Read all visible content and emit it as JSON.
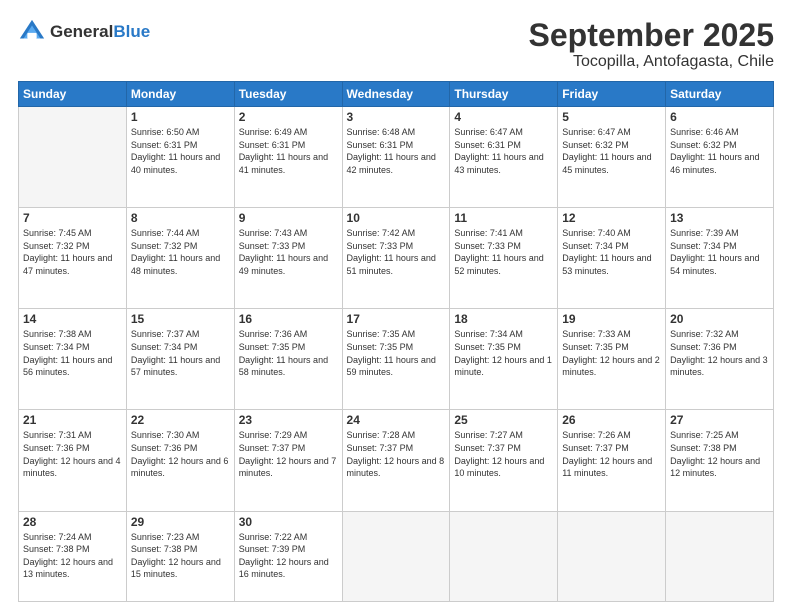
{
  "header": {
    "logo_general": "General",
    "logo_blue": "Blue",
    "main_title": "September 2025",
    "sub_title": "Tocopilla, Antofagasta, Chile"
  },
  "days_of_week": [
    "Sunday",
    "Monday",
    "Tuesday",
    "Wednesday",
    "Thursday",
    "Friday",
    "Saturday"
  ],
  "weeks": [
    [
      {
        "day": "",
        "info": ""
      },
      {
        "day": "1",
        "sunrise": "Sunrise: 6:50 AM",
        "sunset": "Sunset: 6:31 PM",
        "daylight": "Daylight: 11 hours and 40 minutes."
      },
      {
        "day": "2",
        "sunrise": "Sunrise: 6:49 AM",
        "sunset": "Sunset: 6:31 PM",
        "daylight": "Daylight: 11 hours and 41 minutes."
      },
      {
        "day": "3",
        "sunrise": "Sunrise: 6:48 AM",
        "sunset": "Sunset: 6:31 PM",
        "daylight": "Daylight: 11 hours and 42 minutes."
      },
      {
        "day": "4",
        "sunrise": "Sunrise: 6:47 AM",
        "sunset": "Sunset: 6:31 PM",
        "daylight": "Daylight: 11 hours and 43 minutes."
      },
      {
        "day": "5",
        "sunrise": "Sunrise: 6:47 AM",
        "sunset": "Sunset: 6:32 PM",
        "daylight": "Daylight: 11 hours and 45 minutes."
      },
      {
        "day": "6",
        "sunrise": "Sunrise: 6:46 AM",
        "sunset": "Sunset: 6:32 PM",
        "daylight": "Daylight: 11 hours and 46 minutes."
      }
    ],
    [
      {
        "day": "7",
        "sunrise": "Sunrise: 7:45 AM",
        "sunset": "Sunset: 7:32 PM",
        "daylight": "Daylight: 11 hours and 47 minutes."
      },
      {
        "day": "8",
        "sunrise": "Sunrise: 7:44 AM",
        "sunset": "Sunset: 7:32 PM",
        "daylight": "Daylight: 11 hours and 48 minutes."
      },
      {
        "day": "9",
        "sunrise": "Sunrise: 7:43 AM",
        "sunset": "Sunset: 7:33 PM",
        "daylight": "Daylight: 11 hours and 49 minutes."
      },
      {
        "day": "10",
        "sunrise": "Sunrise: 7:42 AM",
        "sunset": "Sunset: 7:33 PM",
        "daylight": "Daylight: 11 hours and 51 minutes."
      },
      {
        "day": "11",
        "sunrise": "Sunrise: 7:41 AM",
        "sunset": "Sunset: 7:33 PM",
        "daylight": "Daylight: 11 hours and 52 minutes."
      },
      {
        "day": "12",
        "sunrise": "Sunrise: 7:40 AM",
        "sunset": "Sunset: 7:34 PM",
        "daylight": "Daylight: 11 hours and 53 minutes."
      },
      {
        "day": "13",
        "sunrise": "Sunrise: 7:39 AM",
        "sunset": "Sunset: 7:34 PM",
        "daylight": "Daylight: 11 hours and 54 minutes."
      }
    ],
    [
      {
        "day": "14",
        "sunrise": "Sunrise: 7:38 AM",
        "sunset": "Sunset: 7:34 PM",
        "daylight": "Daylight: 11 hours and 56 minutes."
      },
      {
        "day": "15",
        "sunrise": "Sunrise: 7:37 AM",
        "sunset": "Sunset: 7:34 PM",
        "daylight": "Daylight: 11 hours and 57 minutes."
      },
      {
        "day": "16",
        "sunrise": "Sunrise: 7:36 AM",
        "sunset": "Sunset: 7:35 PM",
        "daylight": "Daylight: 11 hours and 58 minutes."
      },
      {
        "day": "17",
        "sunrise": "Sunrise: 7:35 AM",
        "sunset": "Sunset: 7:35 PM",
        "daylight": "Daylight: 11 hours and 59 minutes."
      },
      {
        "day": "18",
        "sunrise": "Sunrise: 7:34 AM",
        "sunset": "Sunset: 7:35 PM",
        "daylight": "Daylight: 12 hours and 1 minute."
      },
      {
        "day": "19",
        "sunrise": "Sunrise: 7:33 AM",
        "sunset": "Sunset: 7:35 PM",
        "daylight": "Daylight: 12 hours and 2 minutes."
      },
      {
        "day": "20",
        "sunrise": "Sunrise: 7:32 AM",
        "sunset": "Sunset: 7:36 PM",
        "daylight": "Daylight: 12 hours and 3 minutes."
      }
    ],
    [
      {
        "day": "21",
        "sunrise": "Sunrise: 7:31 AM",
        "sunset": "Sunset: 7:36 PM",
        "daylight": "Daylight: 12 hours and 4 minutes."
      },
      {
        "day": "22",
        "sunrise": "Sunrise: 7:30 AM",
        "sunset": "Sunset: 7:36 PM",
        "daylight": "Daylight: 12 hours and 6 minutes."
      },
      {
        "day": "23",
        "sunrise": "Sunrise: 7:29 AM",
        "sunset": "Sunset: 7:37 PM",
        "daylight": "Daylight: 12 hours and 7 minutes."
      },
      {
        "day": "24",
        "sunrise": "Sunrise: 7:28 AM",
        "sunset": "Sunset: 7:37 PM",
        "daylight": "Daylight: 12 hours and 8 minutes."
      },
      {
        "day": "25",
        "sunrise": "Sunrise: 7:27 AM",
        "sunset": "Sunset: 7:37 PM",
        "daylight": "Daylight: 12 hours and 10 minutes."
      },
      {
        "day": "26",
        "sunrise": "Sunrise: 7:26 AM",
        "sunset": "Sunset: 7:37 PM",
        "daylight": "Daylight: 12 hours and 11 minutes."
      },
      {
        "day": "27",
        "sunrise": "Sunrise: 7:25 AM",
        "sunset": "Sunset: 7:38 PM",
        "daylight": "Daylight: 12 hours and 12 minutes."
      }
    ],
    [
      {
        "day": "28",
        "sunrise": "Sunrise: 7:24 AM",
        "sunset": "Sunset: 7:38 PM",
        "daylight": "Daylight: 12 hours and 13 minutes."
      },
      {
        "day": "29",
        "sunrise": "Sunrise: 7:23 AM",
        "sunset": "Sunset: 7:38 PM",
        "daylight": "Daylight: 12 hours and 15 minutes."
      },
      {
        "day": "30",
        "sunrise": "Sunrise: 7:22 AM",
        "sunset": "Sunset: 7:39 PM",
        "daylight": "Daylight: 12 hours and 16 minutes."
      },
      {
        "day": "",
        "info": ""
      },
      {
        "day": "",
        "info": ""
      },
      {
        "day": "",
        "info": ""
      },
      {
        "day": "",
        "info": ""
      }
    ]
  ]
}
